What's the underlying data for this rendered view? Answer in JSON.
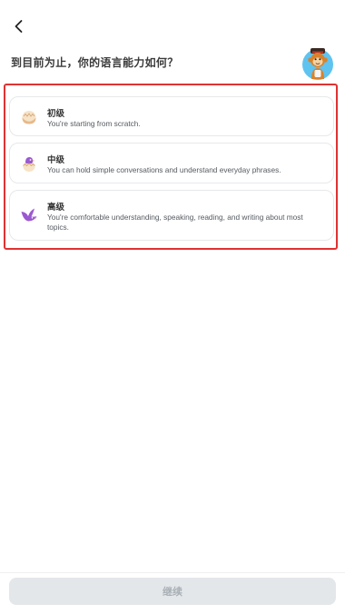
{
  "header": {
    "back_icon": "chevron-left-icon",
    "question": "到目前为止，你的语言能力如何？",
    "mascot_icon": "monkey-mascot-icon"
  },
  "options": [
    {
      "icon": "egg-icon",
      "title": "初级",
      "description": "You're starting from scratch."
    },
    {
      "icon": "hatching-bird-icon",
      "title": "中级",
      "description": "You can hold simple conversations and understand everyday phrases."
    },
    {
      "icon": "flying-bird-icon",
      "title": "高级",
      "description": "You're comfortable understanding, speaking, reading, and writing about most topics."
    }
  ],
  "footer": {
    "continue_label": "继续"
  },
  "colors": {
    "highlight_frame": "#e03232",
    "card_border": "#e6e8ea",
    "button_disabled_bg": "#e3e7ea",
    "button_disabled_text": "#a9b0b6",
    "bird_purple": "#9b59d0",
    "mascot_bg": "#5fc3f0"
  }
}
